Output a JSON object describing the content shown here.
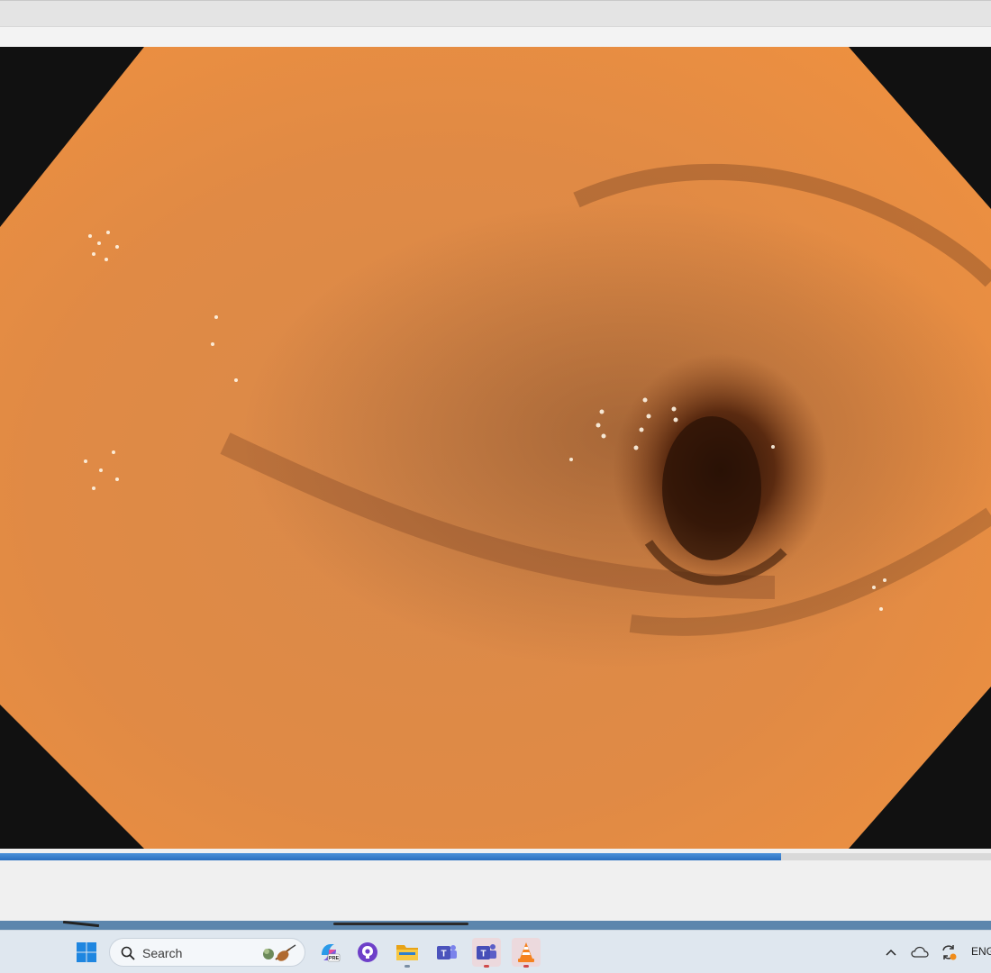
{
  "player": {
    "playback_progress": 0.788,
    "accent_color": "#2a6fbf"
  },
  "taskbar": {
    "search_label": "Search",
    "icons": [
      "windows-start-icon",
      "copilot-icon",
      "github-icon",
      "file-explorer-icon",
      "teams-classic-icon",
      "teams-icon",
      "vlc-icon"
    ],
    "active_app": "vlc-icon"
  },
  "tray": {
    "language": "ENG",
    "icons": [
      "chevron-up-icon",
      "onedrive-icon",
      "sync-icon"
    ]
  }
}
